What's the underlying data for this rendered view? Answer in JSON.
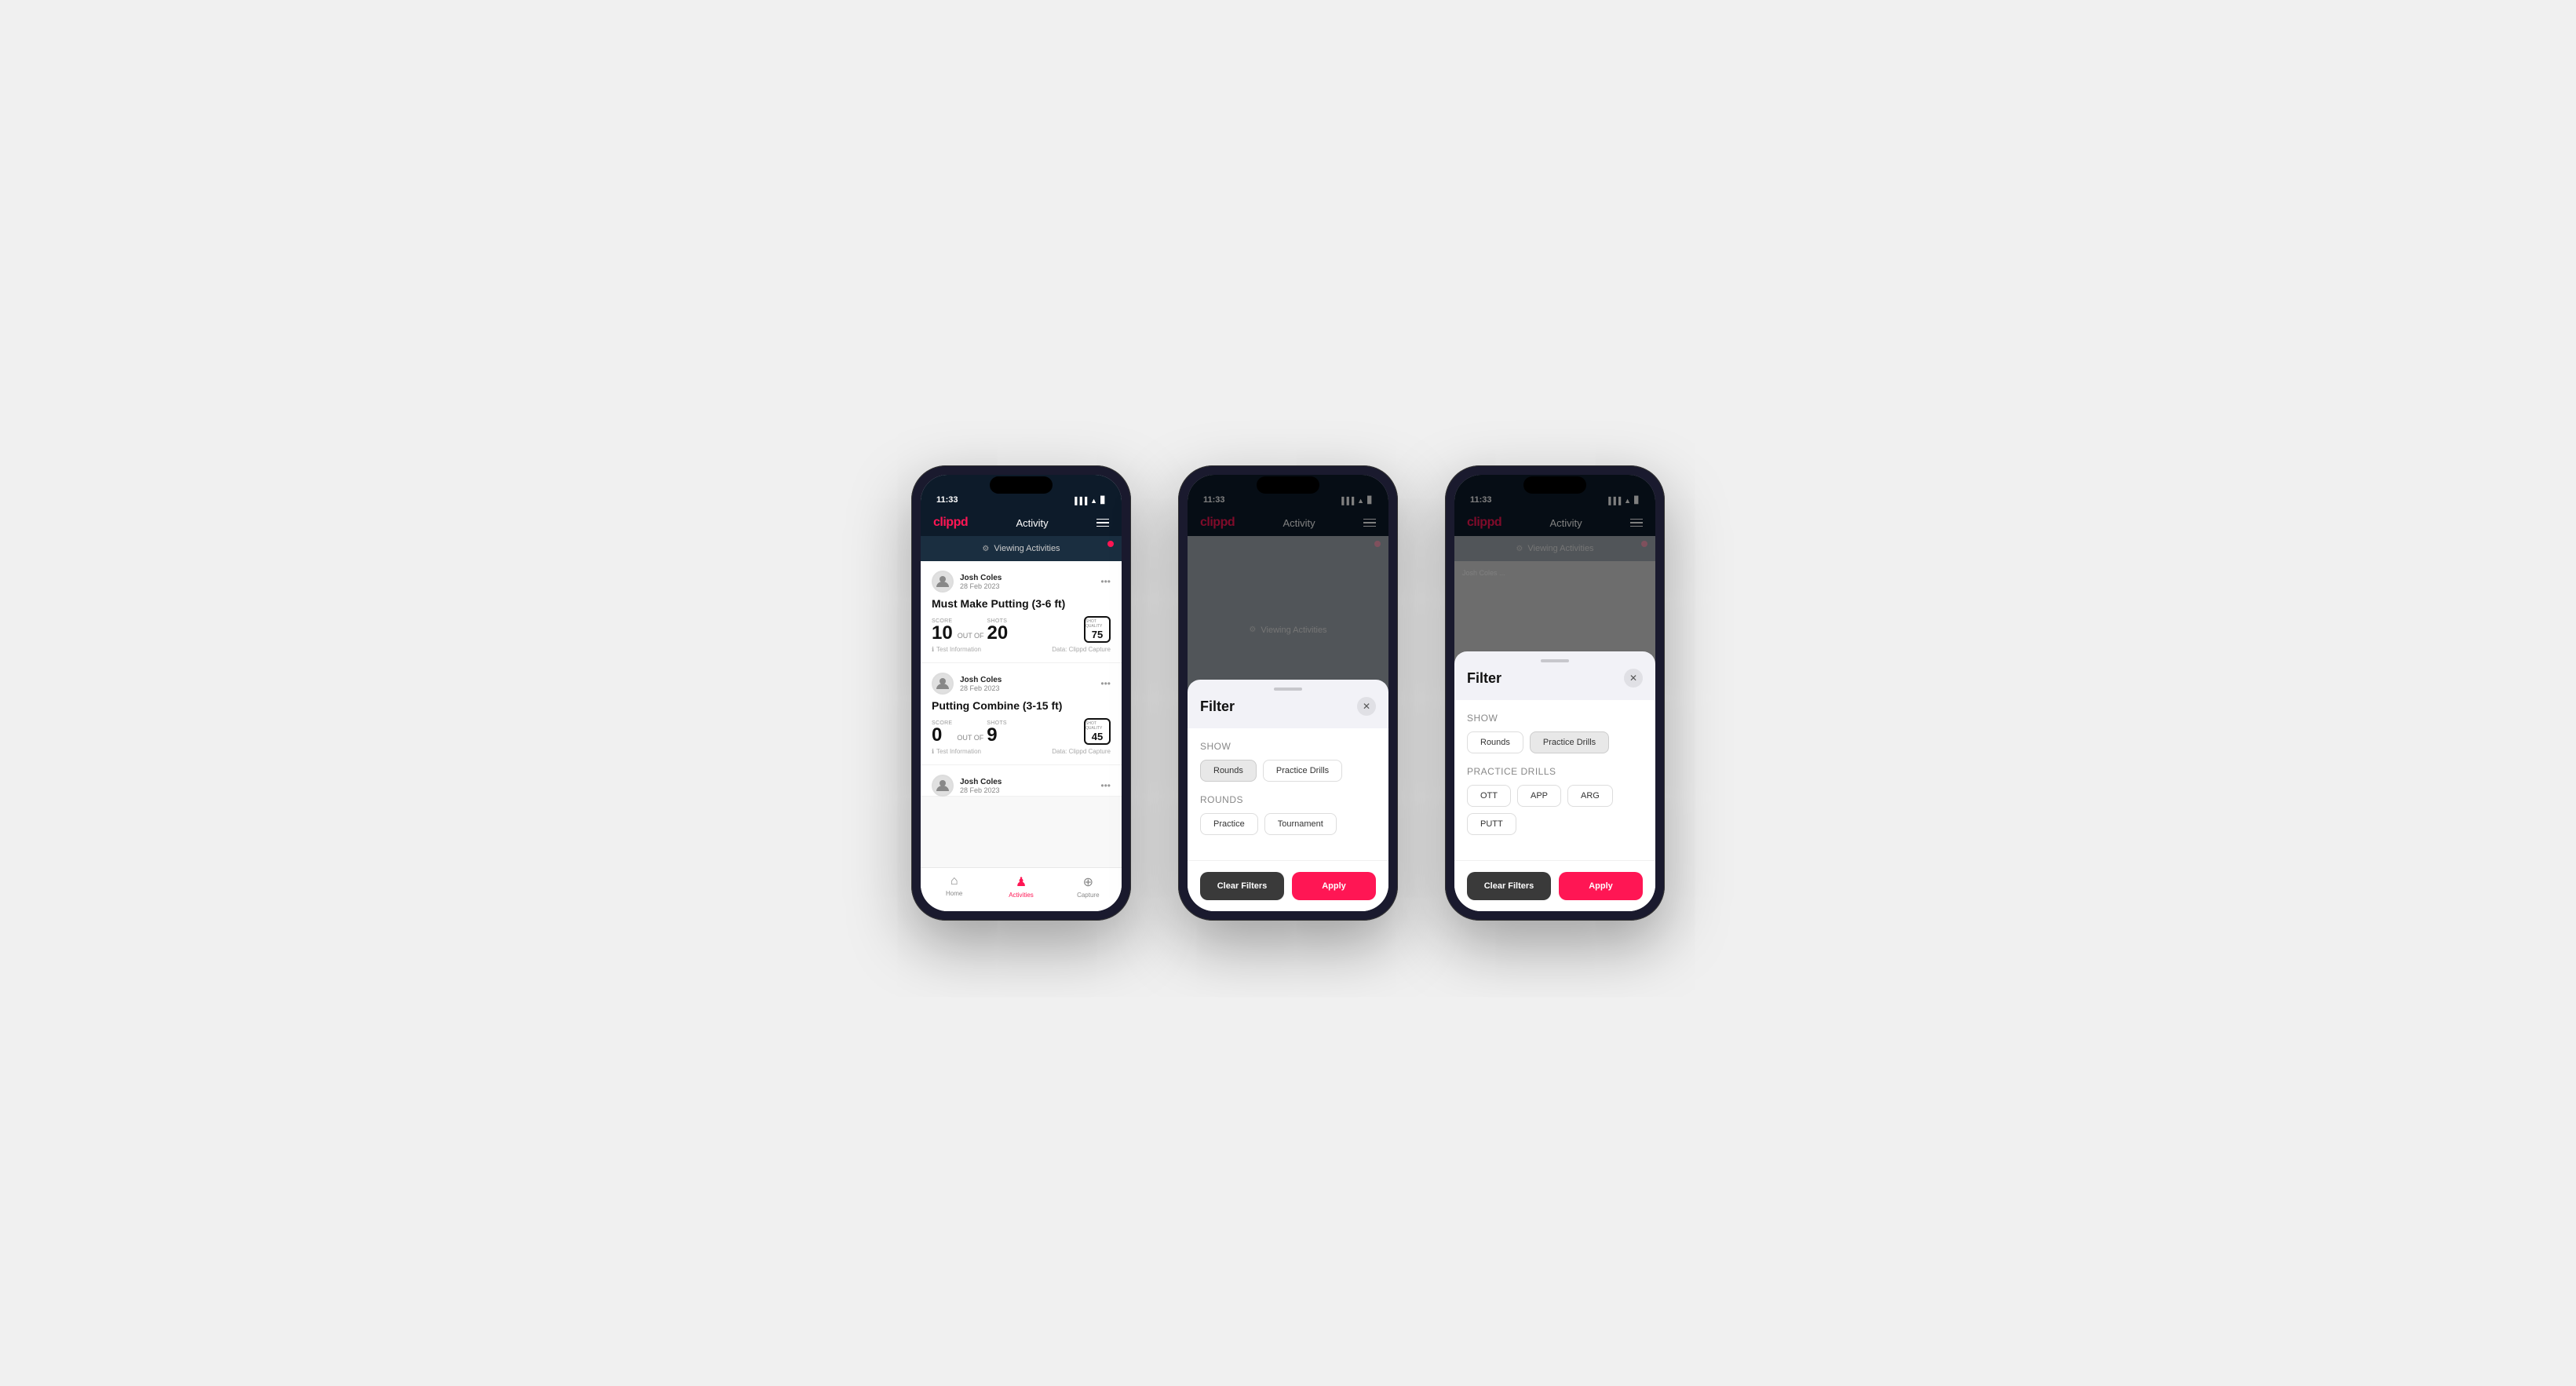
{
  "phones": [
    {
      "id": "phone1",
      "status_time": "11:33",
      "screen": "activities",
      "nav": {
        "logo": "clippd",
        "title": "Activity",
        "menu_icon": "menu"
      },
      "viewing_bar": {
        "text": "Viewing Activities",
        "dot": true
      },
      "activities": [
        {
          "user": "Josh Coles",
          "date": "28 Feb 2023",
          "title": "Must Make Putting (3-6 ft)",
          "score": "10",
          "out_of_label": "OUT OF",
          "shots": "20",
          "shot_quality_label": "Shot Quality",
          "shot_quality": "75",
          "info_label": "Test Information",
          "data_label": "Data: Clippd Capture"
        },
        {
          "user": "Josh Coles",
          "date": "28 Feb 2023",
          "title": "Putting Combine (3-15 ft)",
          "score": "0",
          "out_of_label": "OUT OF",
          "shots": "9",
          "shot_quality_label": "Shot Quality",
          "shot_quality": "45",
          "info_label": "Test Information",
          "data_label": "Data: Clippd Capture"
        },
        {
          "user": "Josh Coles",
          "date": "28 Feb 2023",
          "title": "",
          "score": "",
          "shots": "",
          "shot_quality": "",
          "info_label": "",
          "data_label": ""
        }
      ],
      "tabs": [
        {
          "id": "home",
          "label": "Home",
          "icon": "🏠",
          "active": false
        },
        {
          "id": "activities",
          "label": "Activities",
          "icon": "♟",
          "active": true
        },
        {
          "id": "capture",
          "label": "Capture",
          "icon": "⊕",
          "active": false
        }
      ]
    },
    {
      "id": "phone2",
      "status_time": "11:33",
      "screen": "filter_rounds",
      "nav": {
        "logo": "clippd",
        "title": "Activity",
        "menu_icon": "menu"
      },
      "viewing_bar": {
        "text": "Viewing Activities",
        "dot": true
      },
      "filter": {
        "title": "Filter",
        "show_label": "Show",
        "show_options": [
          {
            "label": "Rounds",
            "selected": true
          },
          {
            "label": "Practice Drills",
            "selected": false
          }
        ],
        "rounds_label": "Rounds",
        "rounds_options": [
          {
            "label": "Practice",
            "selected": false
          },
          {
            "label": "Tournament",
            "selected": false
          }
        ],
        "clear_label": "Clear Filters",
        "apply_label": "Apply"
      }
    },
    {
      "id": "phone3",
      "status_time": "11:33",
      "screen": "filter_drills",
      "nav": {
        "logo": "clippd",
        "title": "Activity",
        "menu_icon": "menu"
      },
      "viewing_bar": {
        "text": "Viewing Activities",
        "dot": true
      },
      "filter": {
        "title": "Filter",
        "show_label": "Show",
        "show_options": [
          {
            "label": "Rounds",
            "selected": false
          },
          {
            "label": "Practice Drills",
            "selected": true
          }
        ],
        "drills_label": "Practice Drills",
        "drills_options": [
          {
            "label": "OTT",
            "selected": false
          },
          {
            "label": "APP",
            "selected": false
          },
          {
            "label": "ARG",
            "selected": false
          },
          {
            "label": "PUTT",
            "selected": false
          }
        ],
        "clear_label": "Clear Filters",
        "apply_label": "Apply"
      }
    }
  ]
}
